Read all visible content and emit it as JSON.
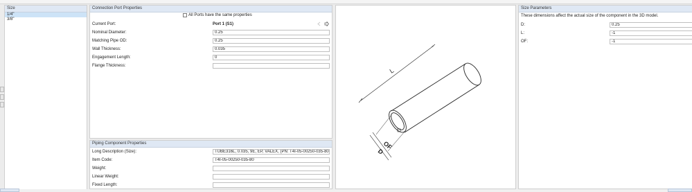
{
  "size_list": {
    "header": "Size",
    "items": [
      "1/4\"",
      "3/8\""
    ]
  },
  "connection_port": {
    "title": "Connection Port Properties",
    "all_ports_label": "All Ports have the same properties",
    "current_port_label": "Current Port:",
    "current_port_value": "Port 1 (S1)",
    "rows": [
      {
        "label": "Nominal Diameter:",
        "value": "0.25"
      },
      {
        "label": "Matching Pipe OD:",
        "value": "0.25"
      },
      {
        "label": "Wall Thickness:",
        "value": "0.035"
      },
      {
        "label": "Engagement Length:",
        "value": "0"
      },
      {
        "label": "Flange Thickness:",
        "value": ""
      }
    ]
  },
  "piping_component": {
    "title": "Piping Component Properties",
    "rows": [
      {
        "label": "Long Description (Size):",
        "value": "TUBE316L, 0.035, 9E, EP, VALEX, (PN: T4I-05-00250-035-80)"
      },
      {
        "label": "Item Code:",
        "value": "T4I-05-00250-035-80"
      },
      {
        "label": "Weight:",
        "value": ""
      },
      {
        "label": "Linear Weight:",
        "value": ""
      },
      {
        "label": "Fixed Length:",
        "value": ""
      }
    ]
  },
  "diagram": {
    "labels": {
      "length": "L",
      "outer": "OF",
      "diameter": "D"
    }
  },
  "size_parameters": {
    "title": "Size Parameters",
    "description": "These dimensions affect the actual size of the component in the 3D model.",
    "rows": [
      {
        "label": "D:",
        "value": "0.25"
      },
      {
        "label": "L:",
        "value": "-1"
      },
      {
        "label": "OF:",
        "value": "-1"
      }
    ]
  },
  "colors": {
    "header_bg": "#dfe8f4",
    "selection": "#cde3f7",
    "border": "#cfcfcf"
  }
}
